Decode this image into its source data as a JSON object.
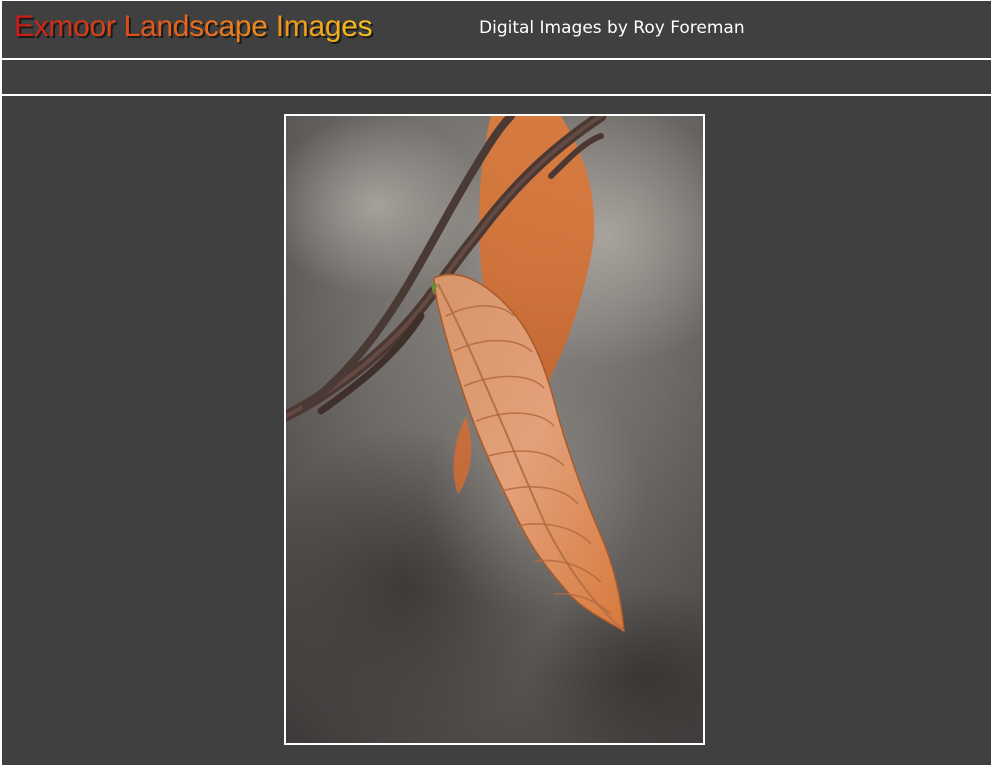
{
  "header": {
    "site_title": "Exmoor Landscape Images",
    "subtitle": "Digital Images by Roy Foreman"
  },
  "main": {
    "photo": {
      "subject_icon": "autumn-leaf-photo"
    }
  },
  "colors": {
    "background": "#404040",
    "separator": "#ffffff",
    "title_gradient_start": "#c81a14",
    "title_gradient_end": "#f5c21c",
    "subtitle_text": "#ffffff",
    "leaf_orange": "#e08a50"
  }
}
